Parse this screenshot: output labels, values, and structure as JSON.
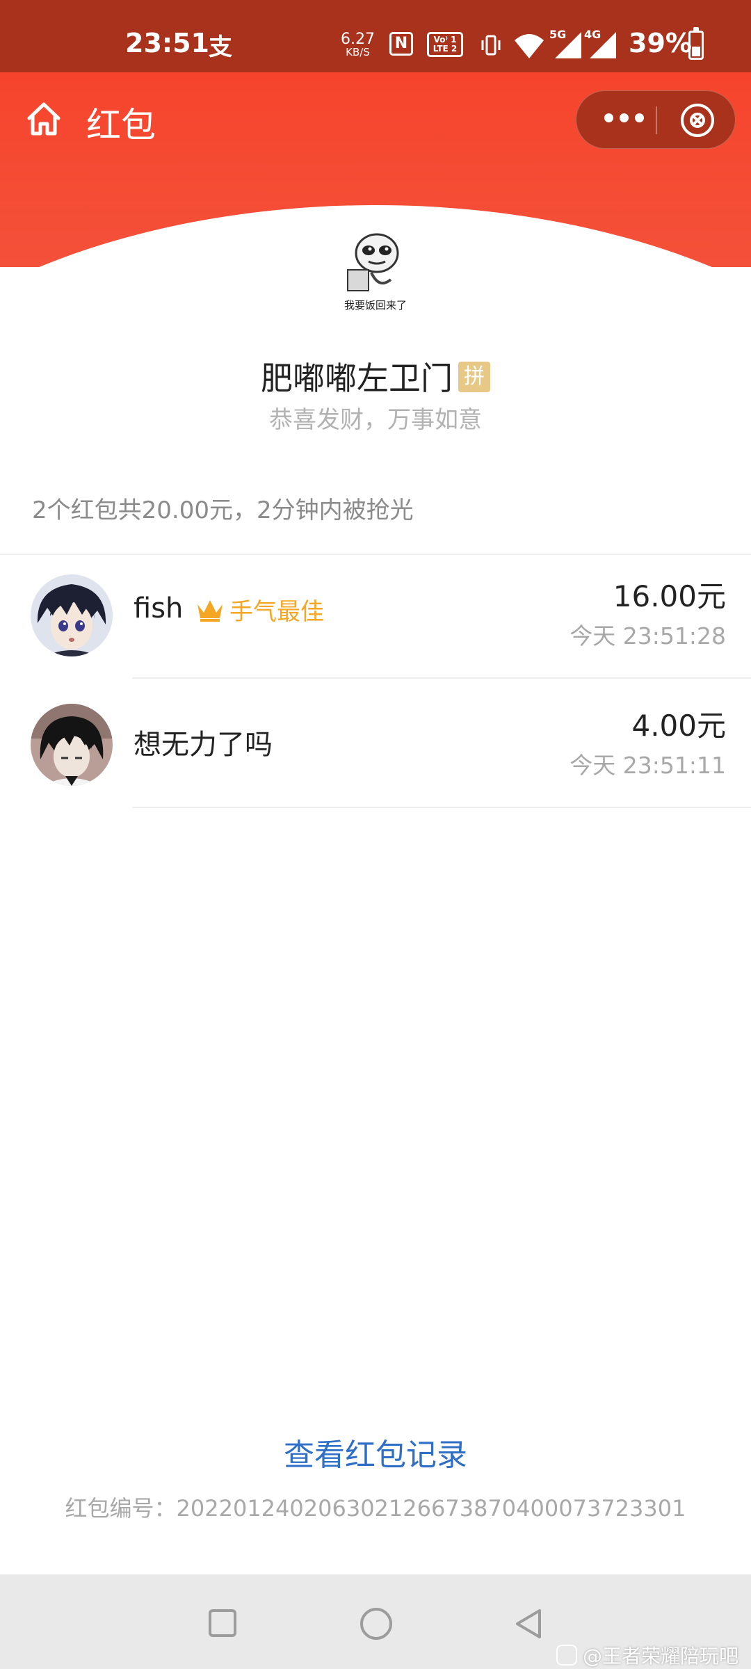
{
  "status_bar": {
    "time": "23:51",
    "pay_glyph": "支",
    "net_speed": "6.27",
    "net_speed_unit": "KB/S",
    "nfc": "N",
    "volte_top": "Vo⁾ 1",
    "volte_bottom": "LTE 2",
    "signal_5g": "5G",
    "signal_4g": "4G",
    "battery": "39%",
    "battery_level": 0.39
  },
  "header": {
    "title": "红包",
    "home_icon": "home-icon",
    "more_icon": "more-dots-icon",
    "close_icon": "close-circle-icon",
    "accent_color": "#f6442c"
  },
  "sender": {
    "avatar_caption": "我要饭回来了",
    "name": "肥嘟嘟左卫门",
    "badge": "拼",
    "greeting": "恭喜发财，万事如意"
  },
  "summary": "2个红包共20.00元，2分钟内被抢光",
  "records": [
    {
      "name": "fish",
      "best_label": "手气最佳",
      "amount": "16.00元",
      "time": "今天 23:51:28"
    },
    {
      "name": "想无力了吗",
      "amount": "4.00元",
      "time": "今天 23:51:11"
    }
  ],
  "footer": {
    "view_records": "查看红包记录",
    "packet_id": "红包编号：20220124020630212667387040007372330​1"
  },
  "watermark": "@王者荣耀陪玩吧"
}
